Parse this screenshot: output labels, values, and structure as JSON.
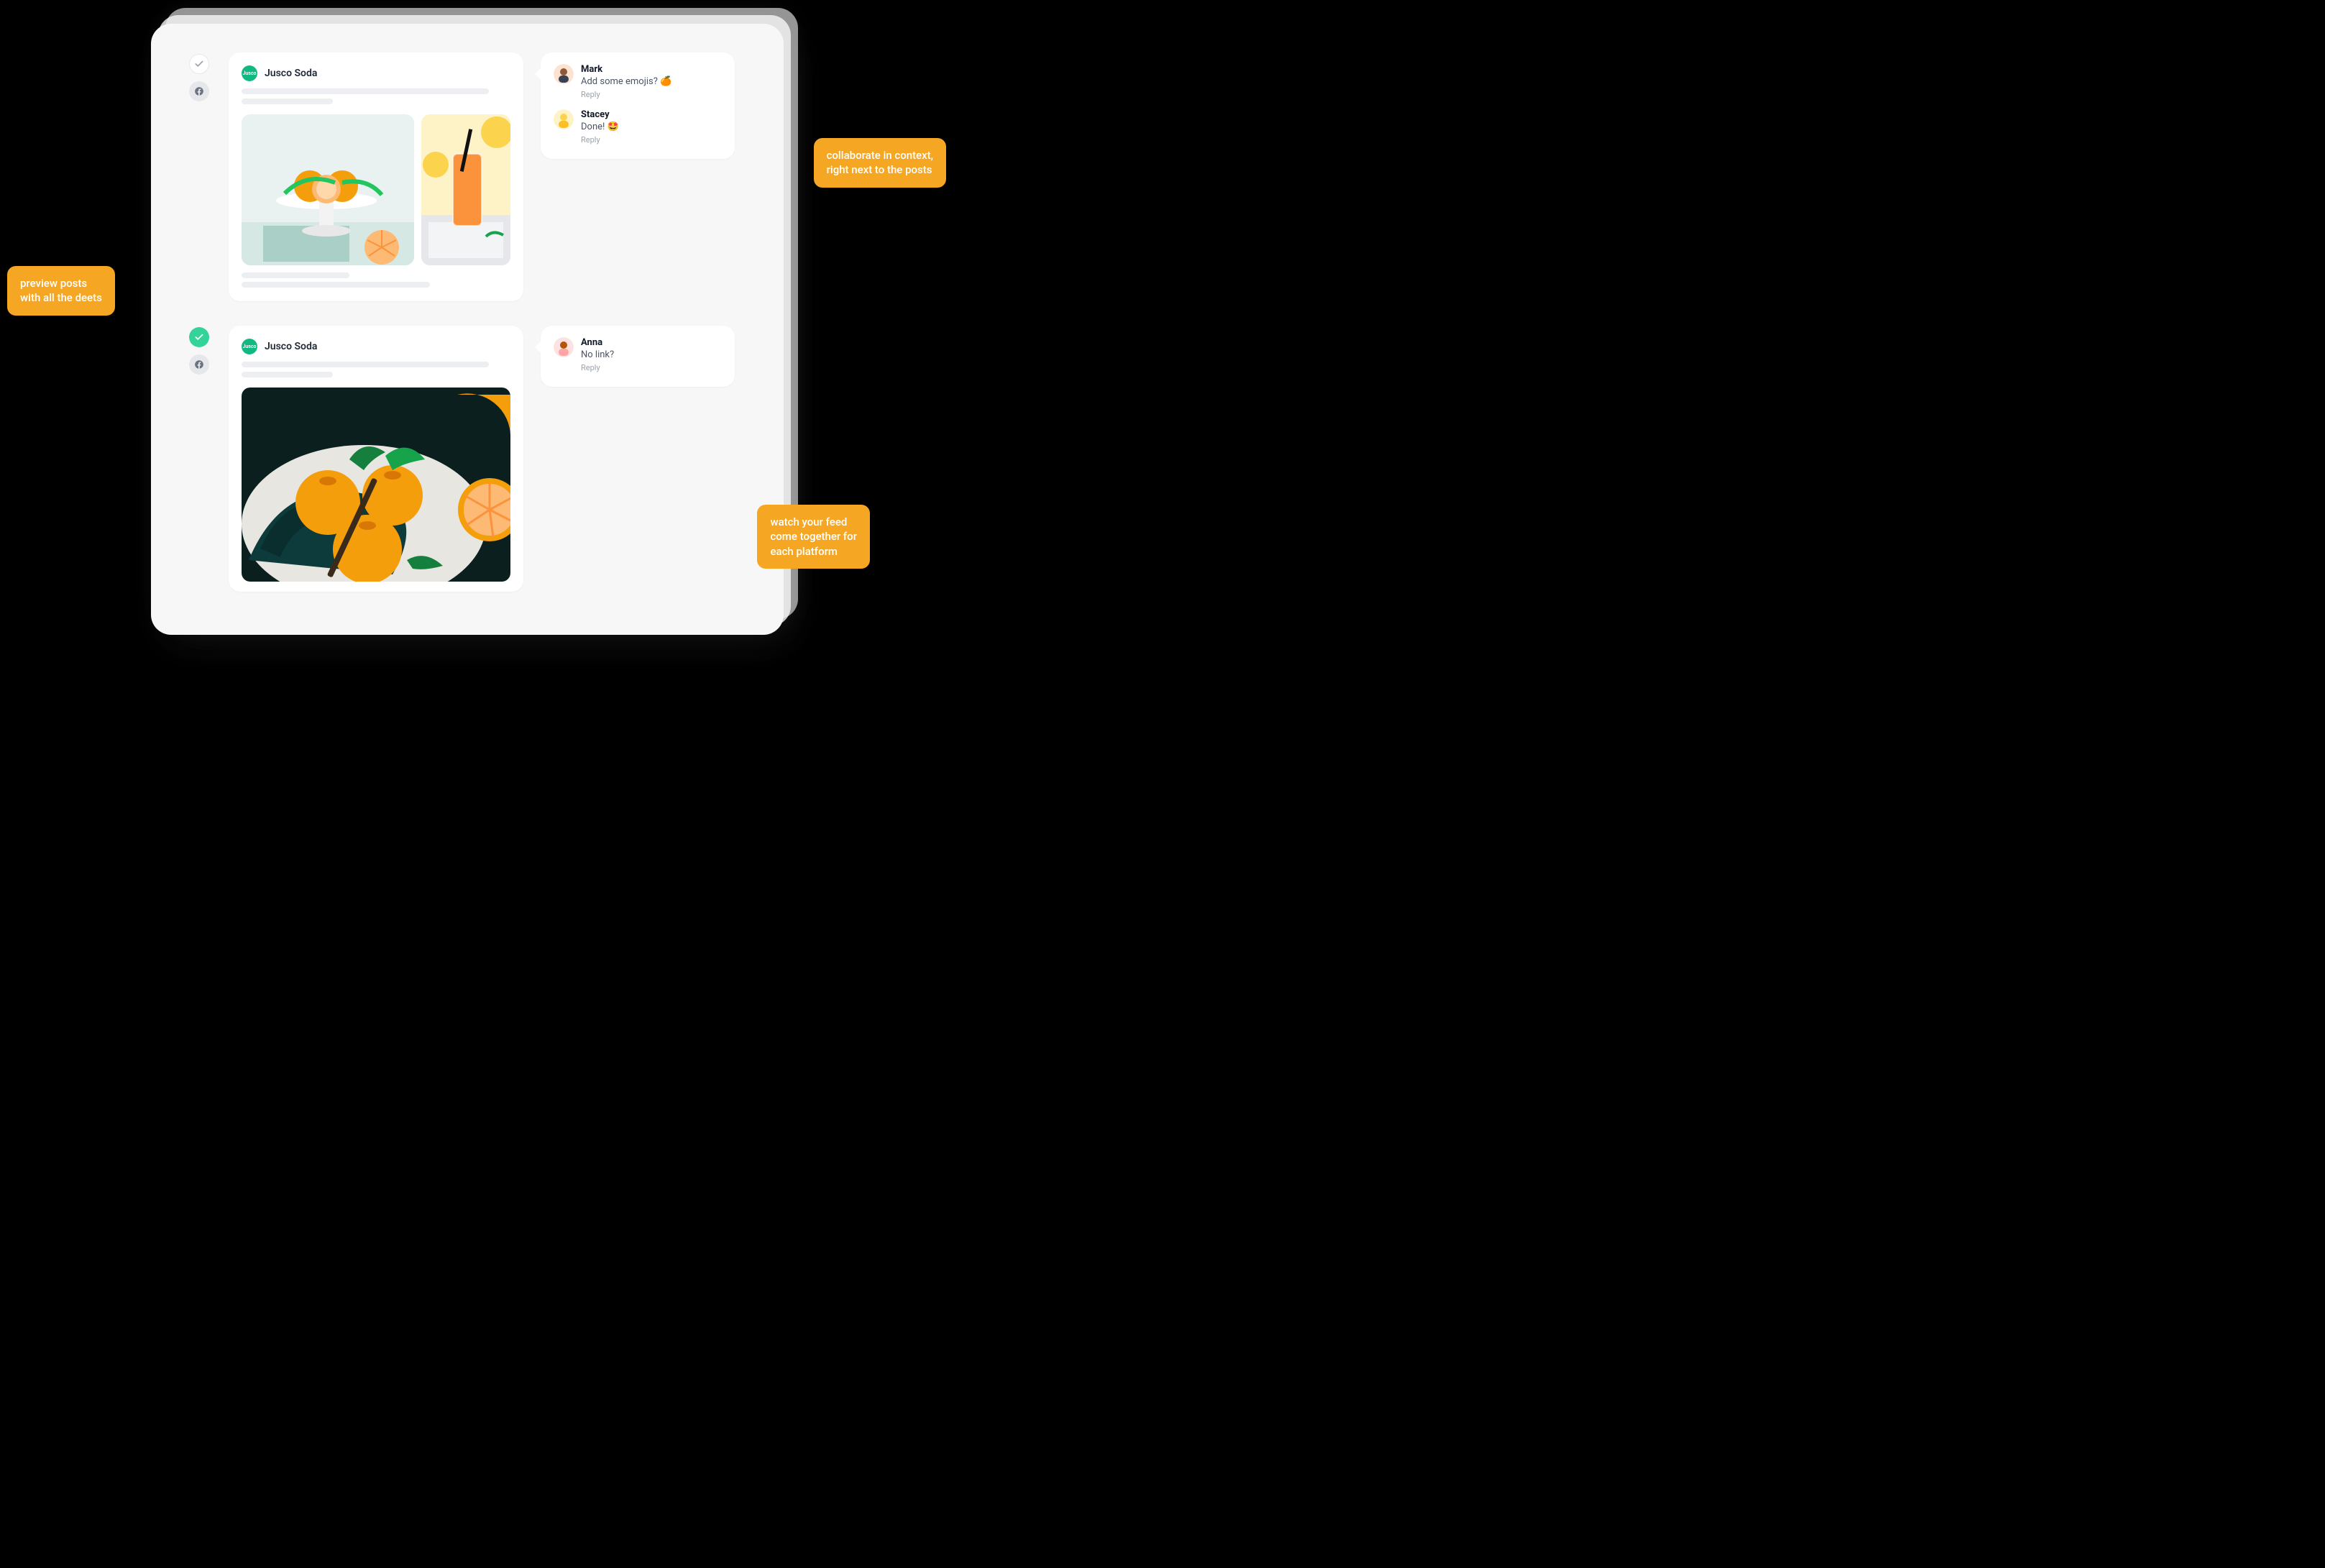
{
  "callouts": {
    "left": "preview posts\nwith all the deets",
    "topRight": "collaborate in context,\nright next to the posts",
    "botRight": "watch your feed\ncome together for\neach platform"
  },
  "posts": [
    {
      "approved": false,
      "brand": "Jusco Soda",
      "brand_tag": "Jusco",
      "comments": [
        {
          "name": "Mark",
          "text": "Add some emojis? 🍊",
          "reply": "Reply"
        },
        {
          "name": "Stacey",
          "text": "Done! 🤩",
          "reply": "Reply"
        }
      ]
    },
    {
      "approved": true,
      "brand": "Jusco Soda",
      "brand_tag": "Jusco",
      "comments": [
        {
          "name": "Anna",
          "text": "No link?",
          "reply": "Reply"
        }
      ]
    }
  ]
}
